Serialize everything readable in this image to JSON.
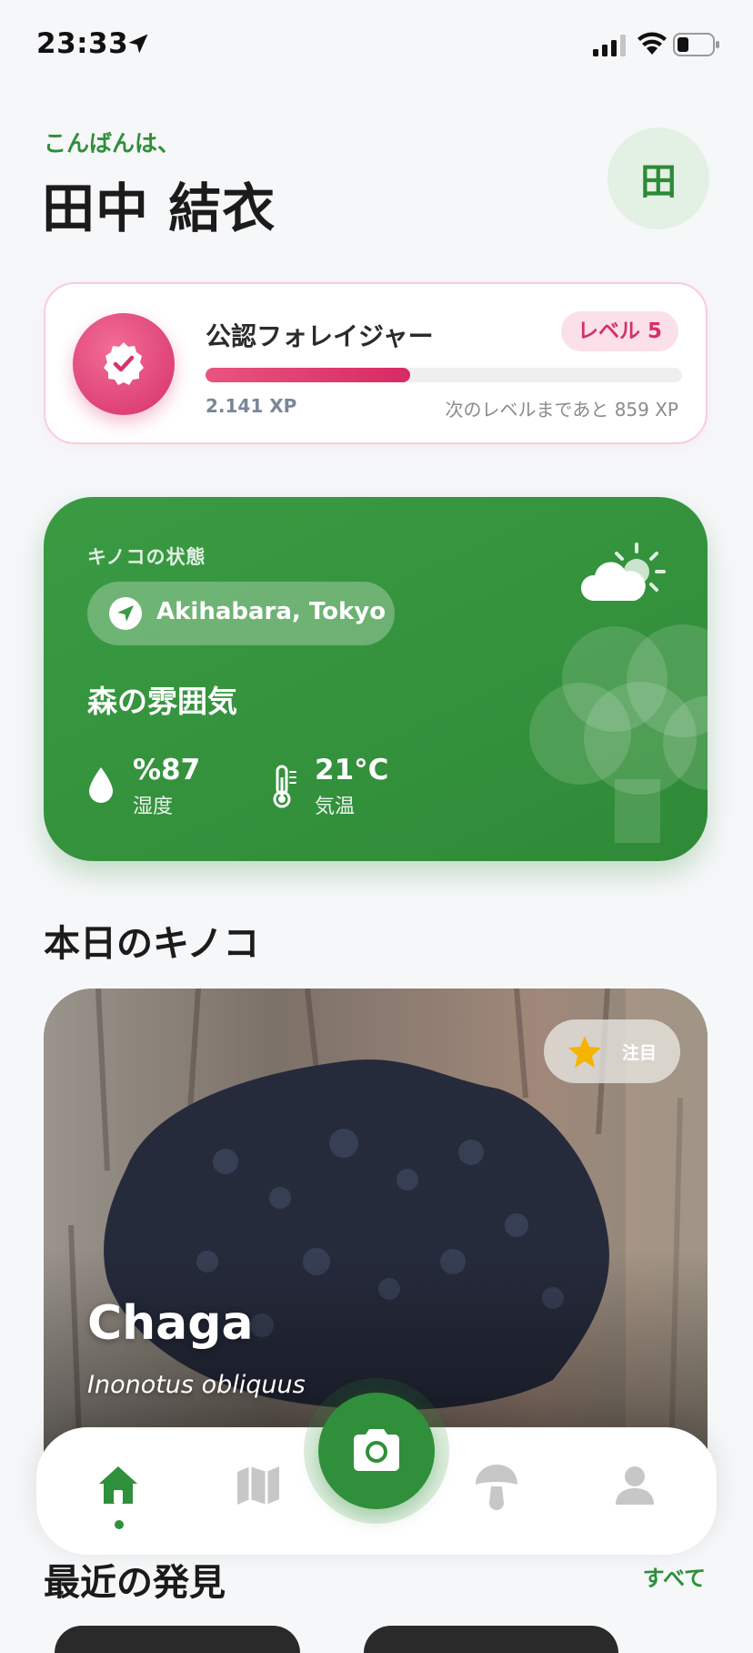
{
  "status_bar": {
    "time": "23:33"
  },
  "header": {
    "greeting": "こんばんは、",
    "user_name": "田中 結衣",
    "avatar_initial": "田"
  },
  "level_card": {
    "title": "公認フォレイジャー",
    "level_label": "レベル 5",
    "xp_current": "2.141 XP",
    "xp_remaining": "次のレベルまであと 859 XP",
    "progress_fraction": 0.43,
    "accent_color": "#d62f69"
  },
  "weather_card": {
    "label": "キノコの状態",
    "location": "Akihabara, Tokyo",
    "atmosphere": "森の雰囲気",
    "humidity_value": "%87",
    "humidity_label": "湿度",
    "temperature_value": "21°C",
    "temperature_label": "気温",
    "icons": [
      "droplet-icon",
      "thermometer-icon",
      "partly-cloudy-icon",
      "tree-icon",
      "navigation-icon"
    ],
    "background_color": "#2f8a37"
  },
  "daily_mushroom": {
    "section_title": "本日のキノコ",
    "featured_label": "注目",
    "name": "Chaga",
    "latin_name": "Inonotus obliquus"
  },
  "recent": {
    "section_title": "最近の発見",
    "see_all_label": "すべて"
  },
  "tab_bar": {
    "items": [
      "home",
      "map",
      "camera",
      "mushrooms",
      "profile"
    ],
    "active": "home",
    "active_color": "#2f8f3a",
    "inactive_color": "#c7c7c7"
  }
}
